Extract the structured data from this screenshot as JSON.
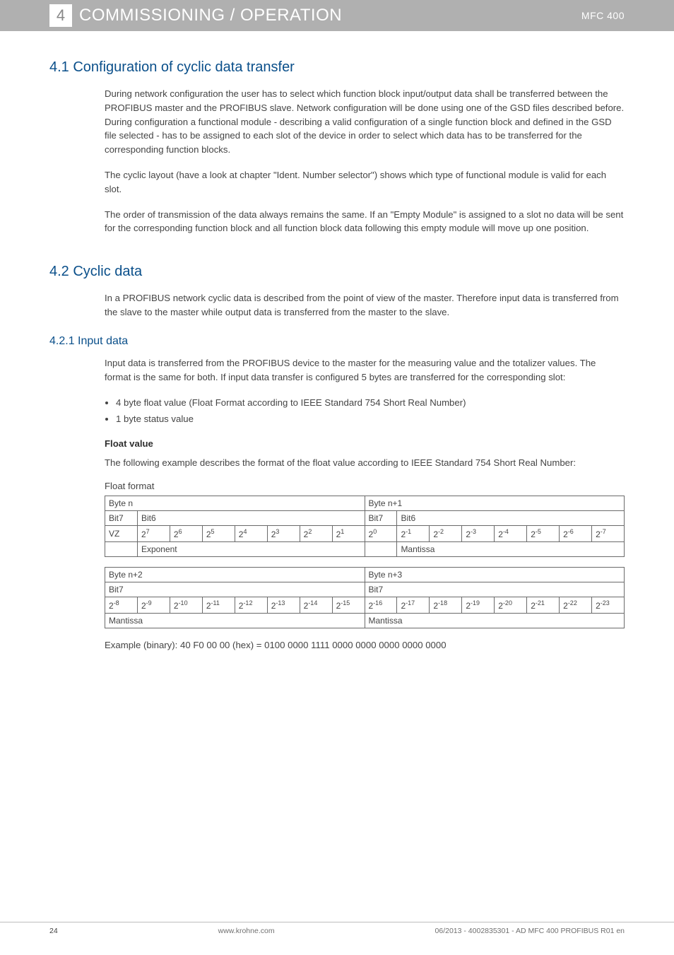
{
  "header": {
    "section_number": "4",
    "title": "COMMISSIONING / OPERATION",
    "doc_id": "MFC 400"
  },
  "sections": {
    "s41": {
      "heading": "4.1  Configuration of cyclic data transfer",
      "p1": "During network configuration the user has to select which function block input/output data shall be transferred between the PROFIBUS master and the PROFIBUS slave. Network configuration will be done using one of the GSD files described before. During configuration a functional module - describing a valid configuration of a single function block and defined in the GSD file selected - has to be assigned to each slot of the device in order to select which data has to be transferred for the corresponding function blocks.",
      "p2": "The cyclic layout (have a look at chapter \"Ident. Number selector\") shows which type of functional module is valid for each slot.",
      "p3": "The order of transmission of the data always remains the same. If an \"Empty Module\" is assigned to a slot no data will be sent for the corresponding function block and all function block data following this empty module will move up one position."
    },
    "s42": {
      "heading": "4.2  Cyclic data",
      "p1": "In a PROFIBUS network cyclic data is described from the point of view of the master. Therefore input data is transferred from the slave to the master while output data is transferred from the master to the slave."
    },
    "s421": {
      "heading": "4.2.1  Input data",
      "p1": "Input data is transferred from the PROFIBUS device to the master for the measuring value and the totalizer values. The format is the same for both. If input data transfer is configured 5 bytes are transferred for the corresponding slot:",
      "b1": "4  byte float value (Float Format according to IEEE Standard 754 Short Real Number)",
      "b2": "1 byte status value",
      "float_label": "Float value",
      "p2": "The following example describes the format of the float value according to IEEE Standard 754 Short Real Number:",
      "format_label": "Float format",
      "example": "Example (binary): 40 F0 00 00 (hex) = 0100 0000 1111 0000 0000 0000 0000 0000"
    }
  },
  "table1": {
    "byte_n": "Byte n",
    "byte_n1": "Byte n+1",
    "bit7": "Bit7",
    "bit6": "Bit6",
    "vz": "VZ",
    "exponent": "Exponent",
    "mantissa": "Mantissa",
    "exps": [
      "7",
      "6",
      "5",
      "4",
      "3",
      "2",
      "1",
      "0",
      "-1",
      "-2",
      "-3",
      "-4",
      "-5",
      "-6",
      "-7"
    ]
  },
  "table2": {
    "byte_n2": "Byte n+2",
    "byte_n3": "Byte n+3",
    "bit7": "Bit7",
    "mantissa": "Mantissa",
    "exps": [
      "-8",
      "-9",
      "-10",
      "-11",
      "-12",
      "-13",
      "-14",
      "-15",
      "-16",
      "-17",
      "-18",
      "-19",
      "-20",
      "-21",
      "-22",
      "-23"
    ]
  },
  "footer": {
    "page": "24",
    "site": "www.krohne.com",
    "doc": "06/2013 - 4002835301 - AD MFC 400 PROFIBUS R01 en"
  }
}
